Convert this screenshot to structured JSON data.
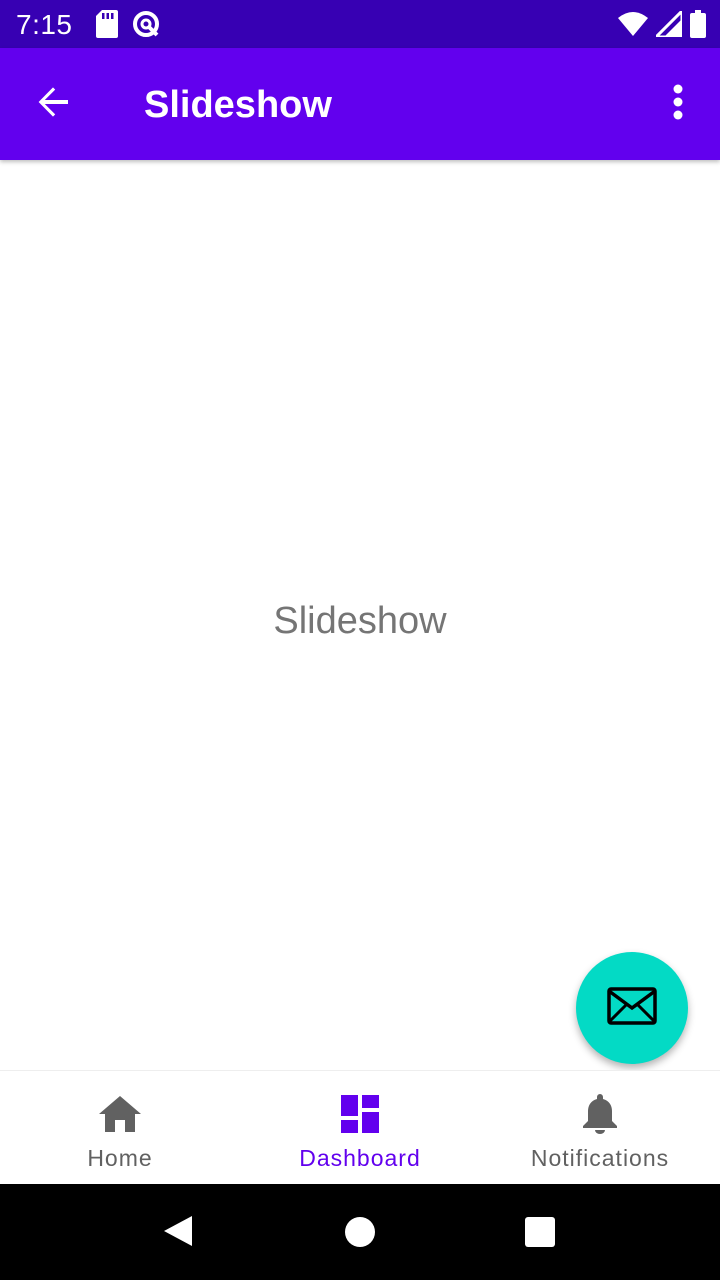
{
  "status_bar": {
    "time": "7:15"
  },
  "app_bar": {
    "title": "Slideshow",
    "back_icon": "arrow-back-icon",
    "overflow_icon": "more-vert-icon"
  },
  "content": {
    "text": "Slideshow"
  },
  "fab": {
    "icon": "email-icon",
    "color": "#03dac5"
  },
  "bottom_nav": {
    "items": [
      {
        "label": "Home",
        "icon": "home-icon",
        "active": false
      },
      {
        "label": "Dashboard",
        "icon": "dashboard-icon",
        "active": true
      },
      {
        "label": "Notifications",
        "icon": "bell-icon",
        "active": false
      }
    ]
  },
  "colors": {
    "primary": "#6200ee",
    "primary_dark": "#3700b3",
    "secondary": "#03dac5",
    "inactive": "#616161"
  }
}
